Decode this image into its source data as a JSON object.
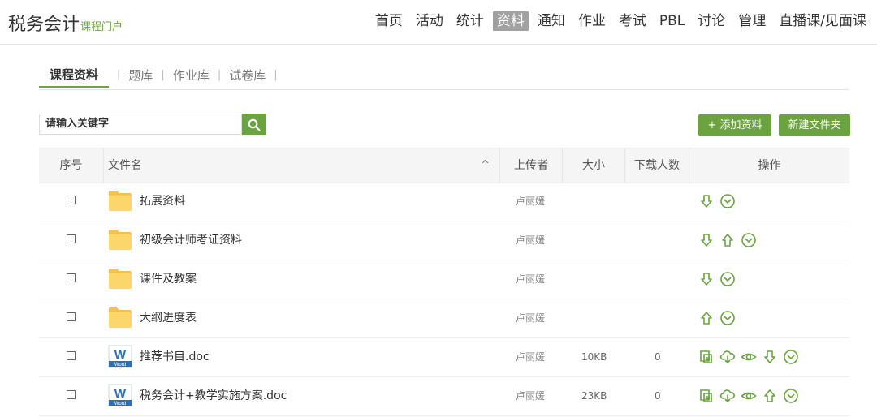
{
  "header": {
    "brand": "税务会计",
    "brand_sub": "课程门户",
    "nav": [
      "首页",
      "活动",
      "统计",
      "资料",
      "通知",
      "作业",
      "考试",
      "PBL",
      "讨论",
      "管理",
      "直播课/见面课"
    ],
    "active_nav": "资料"
  },
  "subtabs": [
    "课程资料",
    "题库",
    "作业库",
    "试卷库"
  ],
  "separator": "|",
  "search": {
    "value": "请输入关键字"
  },
  "buttons": {
    "add": "+ 添加资料",
    "new_folder": "新建文件夹"
  },
  "table": {
    "columns": [
      "序号",
      "文件名",
      "上传者",
      "大小",
      "下载人数",
      "操作"
    ],
    "sort_indicator": "^",
    "rows": [
      {
        "name": "拓展资料",
        "type": "folder",
        "uploader": "卢丽媛",
        "size": "",
        "downloads": "",
        "ops": [
          "download-icon",
          "more-icon"
        ]
      },
      {
        "name": "初级会计师考证资料",
        "type": "folder",
        "uploader": "卢丽媛",
        "size": "",
        "downloads": "",
        "ops": [
          "download-icon",
          "upload-icon",
          "more-icon"
        ]
      },
      {
        "name": "课件及教案",
        "type": "folder",
        "uploader": "卢丽媛",
        "size": "",
        "downloads": "",
        "ops": [
          "download-icon",
          "more-icon"
        ]
      },
      {
        "name": "大纲进度表",
        "type": "folder",
        "uploader": "卢丽媛",
        "size": "",
        "downloads": "",
        "ops": [
          "upload-icon",
          "more-icon"
        ]
      },
      {
        "name": "推荐书目.doc",
        "type": "word",
        "uploader": "卢丽媛",
        "size": "10KB",
        "downloads": "0",
        "ops": [
          "copy-icon",
          "cloud-icon",
          "preview-icon",
          "download-icon",
          "more-icon"
        ]
      },
      {
        "name": "税务会计+教学实施方案.doc",
        "type": "word",
        "uploader": "卢丽媛",
        "size": "23KB",
        "downloads": "0",
        "ops": [
          "copy-icon",
          "cloud-icon",
          "preview-icon",
          "upload-icon",
          "more-icon"
        ]
      }
    ]
  },
  "word_icon": {
    "letter": "W",
    "caption": "Word"
  },
  "colors": {
    "accent": "#6aa33f",
    "folder": "#f6c94a",
    "word": "#2a6fba"
  }
}
